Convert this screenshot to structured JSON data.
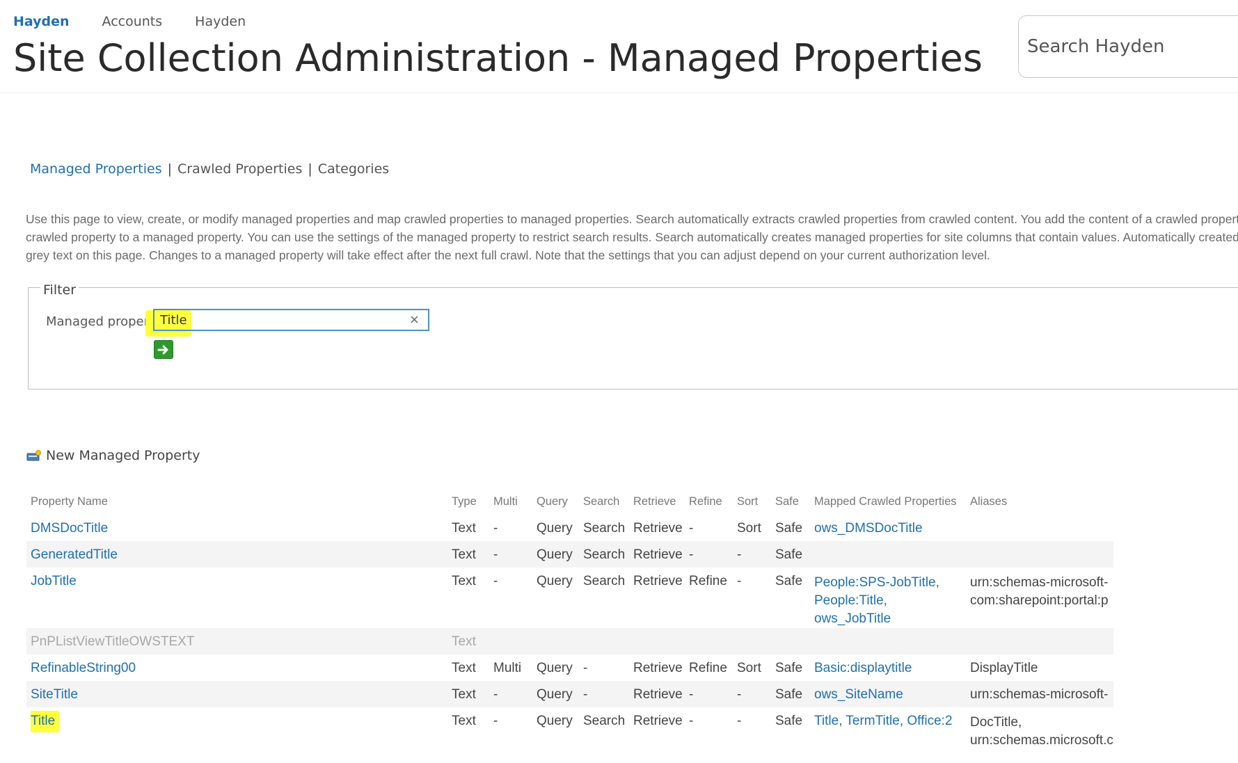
{
  "topnav": {
    "items": [
      "Hayden",
      "Accounts",
      "Hayden"
    ]
  },
  "header": {
    "title": "Site Collection Administration - Managed Properties",
    "search_placeholder": "Search Hayden"
  },
  "subnav": {
    "items": [
      "Managed Properties",
      "Crawled Properties",
      "Categories"
    ],
    "separator": "|"
  },
  "description": {
    "lines": [
      "Use this page to view, create, or modify managed properties and map crawled properties to managed properties. Search automatically extracts crawled properties from crawled content. You add the content of a crawled property",
      "crawled property to a managed property. You can use the settings of the managed property to restrict search results. Search automatically creates managed properties for site columns that contain values. Automatically created r",
      "grey text on this page. Changes to a managed property will take effect after the next full crawl. Note that the settings that you can adjust depend on your current authorization level."
    ]
  },
  "filter": {
    "legend": "Filter",
    "label": "Managed property",
    "value": "Title",
    "clear_icon": "×"
  },
  "new_property": {
    "label": "New Managed Property"
  },
  "table": {
    "headers": [
      "Property Name",
      "Type",
      "Multi",
      "Query",
      "Search",
      "Retrieve",
      "Refine",
      "Sort",
      "Safe",
      "Mapped Crawled Properties",
      "Aliases"
    ],
    "rows": [
      {
        "name": "DMSDocTitle",
        "type": "Text",
        "multi": "-",
        "query": "Query",
        "search": "Search",
        "retrieve": "Retrieve",
        "refine": "-",
        "sort": "Sort",
        "safe": "Safe",
        "mapped": [
          "ows_DMSDocTitle"
        ],
        "aliases": []
      },
      {
        "name": "GeneratedTitle",
        "type": "Text",
        "multi": "-",
        "query": "Query",
        "search": "Search",
        "retrieve": "Retrieve",
        "refine": "-",
        "sort": "-",
        "safe": "Safe",
        "mapped": [],
        "aliases": []
      },
      {
        "name": "JobTitle",
        "type": "Text",
        "multi": "-",
        "query": "Query",
        "search": "Search",
        "retrieve": "Retrieve",
        "refine": "Refine",
        "sort": "-",
        "safe": "Safe",
        "mapped": [
          "People:SPS-JobTitle,",
          "People:Title,",
          "ows_JobTitle"
        ],
        "aliases": [
          "urn:schemas-microsoft-",
          "com:sharepoint:portal:p"
        ]
      },
      {
        "name": "PnPListViewTitleOWSTEXT",
        "type": "Text",
        "multi": "",
        "query": "",
        "search": "",
        "retrieve": "",
        "refine": "",
        "sort": "",
        "safe": "",
        "mapped": [],
        "aliases": []
      },
      {
        "name": "RefinableString00",
        "type": "Text",
        "multi": "Multi",
        "query": "Query",
        "search": "-",
        "retrieve": "Retrieve",
        "refine": "Refine",
        "sort": "Sort",
        "safe": "Safe",
        "mapped": [
          "Basic:displaytitle"
        ],
        "aliases": [
          "DisplayTitle"
        ]
      },
      {
        "name": "SiteTitle",
        "type": "Text",
        "multi": "-",
        "query": "Query",
        "search": "-",
        "retrieve": "Retrieve",
        "refine": "-",
        "sort": "-",
        "safe": "Safe",
        "mapped": [
          "ows_SiteName"
        ],
        "aliases": [
          "urn:schemas-microsoft-"
        ]
      },
      {
        "name": "Title",
        "type": "Text",
        "multi": "-",
        "query": "Query",
        "search": "Search",
        "retrieve": "Retrieve",
        "refine": "-",
        "sort": "-",
        "safe": "Safe",
        "mapped": [
          "Title,",
          "TermTitle,",
          "Office:2"
        ],
        "aliases": [
          "DocTitle,",
          "urn:schemas.microsoft.c"
        ]
      }
    ]
  },
  "colors": {
    "link": "#1f6fb2",
    "highlight": "#ffff3b",
    "go_button": "#2e9a2e"
  }
}
